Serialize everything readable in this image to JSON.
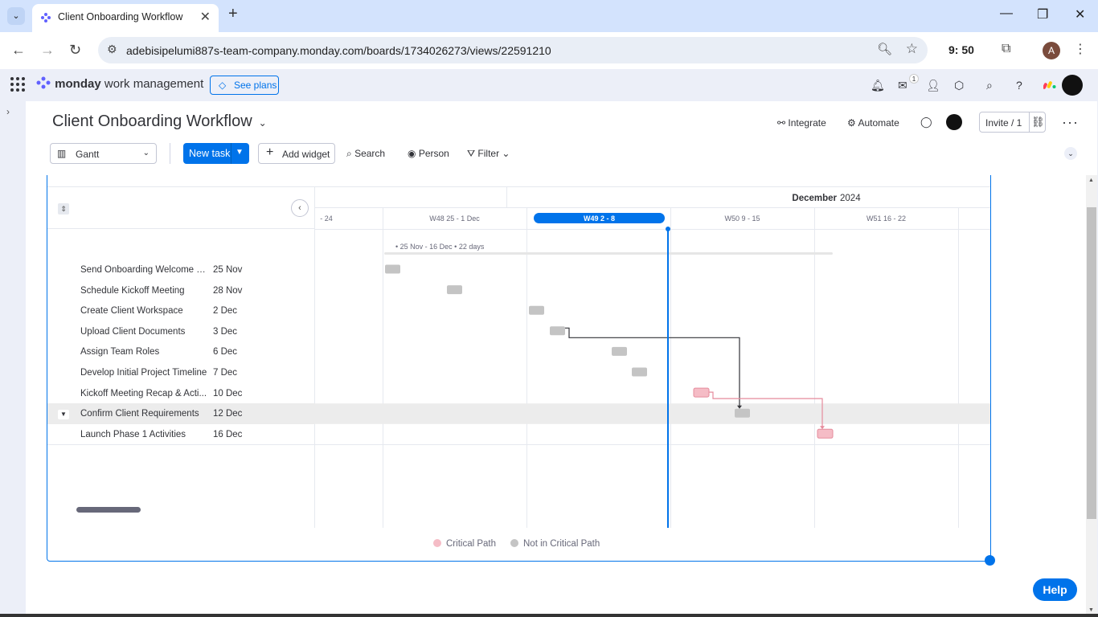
{
  "browser": {
    "tab_title": "Client Onboarding Workflow",
    "url": "adebisipelumi887s-team-company.monday.com/boards/1734026273/views/22591210",
    "clock": "9:  50",
    "profile_initial": "A"
  },
  "monday_top": {
    "logo_bold": "monday",
    "logo_light": " work management",
    "see_plans": "See plans",
    "inbox_badge": "1"
  },
  "board": {
    "title": "Client Onboarding Workflow",
    "integrate": "Integrate",
    "automate": "Automate",
    "invite": "Invite / 1"
  },
  "toolbar": {
    "view": "Gantt",
    "new_task": "New task",
    "add_widget": "Add widget",
    "search": "Search",
    "person": "Person",
    "filter": "Filter"
  },
  "gantt": {
    "month": "December",
    "year": "2024",
    "weeks": [
      "- 24",
      "W48 25 - 1 Dec",
      "W49 2 - 8",
      "W50 9 - 15",
      "W51 16 - 22"
    ],
    "current_week_index": 2,
    "summary": "• 25 Nov - 16 Dec • 22 days",
    "tasks": [
      {
        "name": "Send Onboarding Welcome E...",
        "date": "25 Nov",
        "critical": false
      },
      {
        "name": "Schedule Kickoff Meeting",
        "date": "28 Nov",
        "critical": false
      },
      {
        "name": "Create Client Workspace",
        "date": "2 Dec",
        "critical": false
      },
      {
        "name": "Upload Client Documents",
        "date": "3 Dec",
        "critical": false
      },
      {
        "name": "Assign Team Roles",
        "date": "6 Dec",
        "critical": false
      },
      {
        "name": "Develop Initial Project Timeline",
        "date": "7 Dec",
        "critical": false
      },
      {
        "name": "Kickoff Meeting Recap & Acti...",
        "date": "10 Dec",
        "critical": true
      },
      {
        "name": "Confirm Client Requirements",
        "date": "12 Dec",
        "critical": false
      },
      {
        "name": "Launch Phase 1 Activities",
        "date": "16 Dec",
        "critical": true
      }
    ],
    "selected_task_index": 7,
    "legend": {
      "critical": "Critical Path",
      "not_critical": "Not in Critical Path",
      "critical_color": "#f5bcc6",
      "not_critical_color": "#c4c4c4"
    }
  },
  "help": "Help"
}
